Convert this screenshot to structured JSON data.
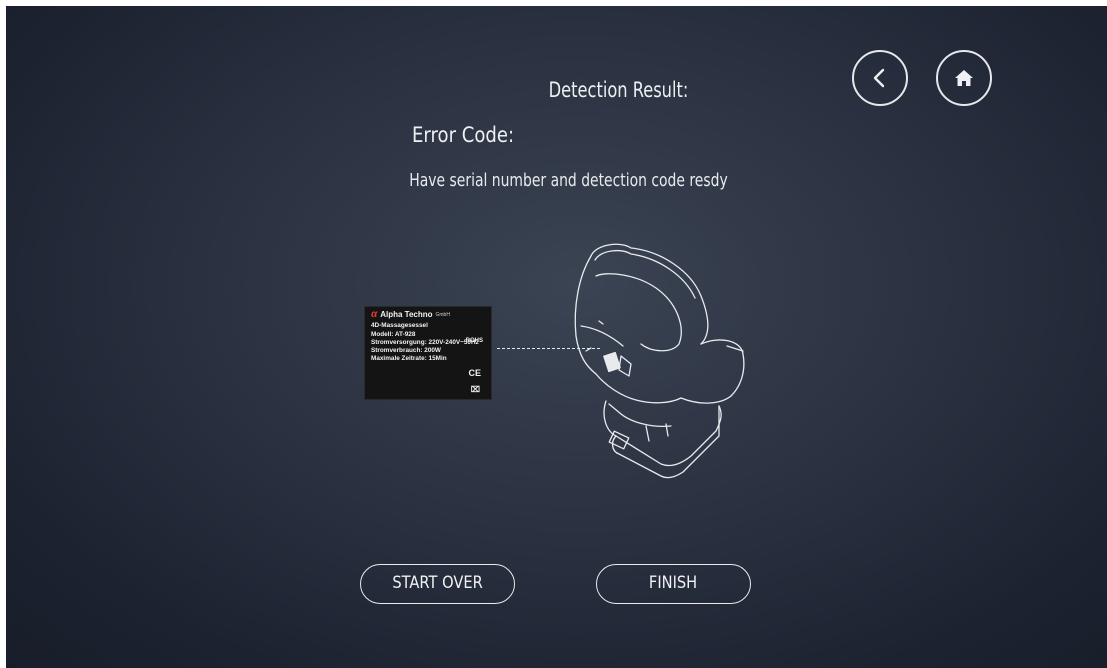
{
  "header": {
    "detection_title": "Detection Result:",
    "error_code_label": "Error Code:",
    "instructions": "Have serial number and detection code resdy"
  },
  "nav": {
    "back_icon": "chevron-left-icon",
    "home_icon": "home-icon"
  },
  "label_card": {
    "logo_glyph": "α",
    "brand": "Alpha Techno",
    "brand_suffix": "GmbH",
    "product": "4D-Massagesessel",
    "model": "Modell: AT-928",
    "power_supply": "Stromversorgung: 220V-240V~50Hz",
    "power_consumption": "Stromverbrauch: 200W",
    "max_runtime": "Maximale Zeitrate: 15Min",
    "rohs": "ROHS",
    "ce": "CE",
    "bin": "⌧"
  },
  "buttons": {
    "start_over": "START OVER",
    "finish": "FINISH"
  },
  "colors": {
    "background_center": "#3b4453",
    "background_edge": "#181d29",
    "foreground": "#eef0f3",
    "logo_red": "#e53a2a"
  }
}
